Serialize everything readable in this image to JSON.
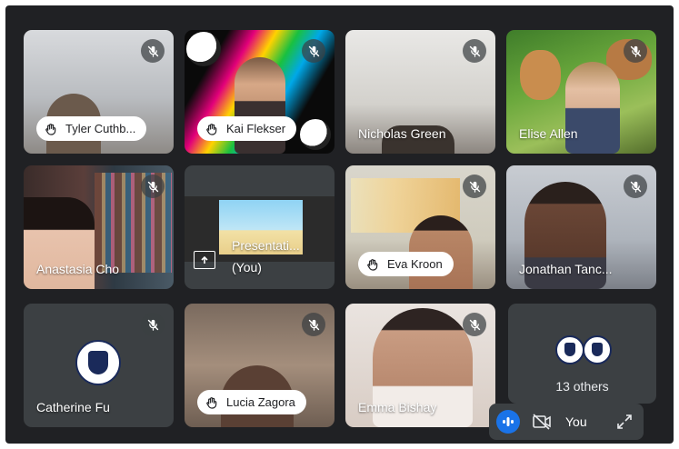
{
  "participants": [
    {
      "name": "Tyler Cuthb...",
      "hand_raised": true,
      "muted": true
    },
    {
      "name": "Kai Flekser",
      "hand_raised": true,
      "muted": true
    },
    {
      "name": "Nicholas Green",
      "hand_raised": false,
      "muted": true
    },
    {
      "name": "Elise Allen",
      "hand_raised": false,
      "muted": true
    },
    {
      "name": "Anastasia Cho",
      "hand_raised": false,
      "muted": true
    },
    {
      "name": "Presentati...",
      "sub": "(You)",
      "hand_raised": false,
      "muted": false
    },
    {
      "name": "Eva Kroon",
      "hand_raised": true,
      "muted": true
    },
    {
      "name": "Jonathan Tanc...",
      "hand_raised": false,
      "muted": true
    },
    {
      "name": "Catherine Fu",
      "hand_raised": false,
      "muted": true
    },
    {
      "name": "Lucia Zagora",
      "hand_raised": true,
      "muted": true
    },
    {
      "name": "Emma Bishay",
      "hand_raised": false,
      "muted": true
    }
  ],
  "others": {
    "label": "13 others"
  },
  "self_view": {
    "label": "You"
  },
  "colors": {
    "background": "#202124",
    "tile": "#3c4043",
    "accent": "#1a73e8"
  },
  "icons": [
    "mic-off-icon",
    "raise-hand-icon",
    "present-screen-icon",
    "audio-level-icon",
    "camera-off-icon",
    "expand-icon"
  ]
}
